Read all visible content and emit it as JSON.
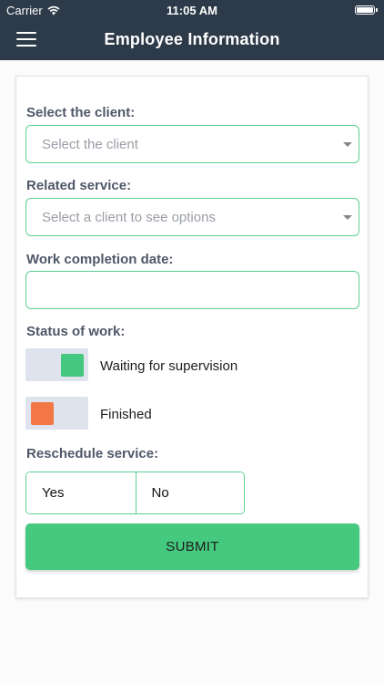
{
  "status_bar": {
    "carrier": "Carrier",
    "time": "11:05 AM"
  },
  "nav": {
    "title": "Employee Information",
    "menu_icon": "hamburger-menu-icon"
  },
  "form": {
    "client": {
      "label": "Select the client:",
      "placeholder": "Select the client"
    },
    "service": {
      "label": "Related service:",
      "placeholder": "Select a client to see options"
    },
    "completion_date": {
      "label": "Work completion date:",
      "value": ""
    },
    "status": {
      "label": "Status of work:",
      "options": [
        {
          "label": "Waiting for supervision",
          "on": true
        },
        {
          "label": "Finished",
          "on": false
        }
      ]
    },
    "reschedule": {
      "label": "Reschedule service:",
      "options": [
        "Yes",
        "No"
      ]
    },
    "submit_label": "SUBMIT"
  },
  "colors": {
    "nav_bg": "#2c3a49",
    "accent_green": "#44c77f",
    "accent_orange": "#f37744",
    "border_green": "#5bcf91",
    "label_gray": "#4f5869"
  }
}
